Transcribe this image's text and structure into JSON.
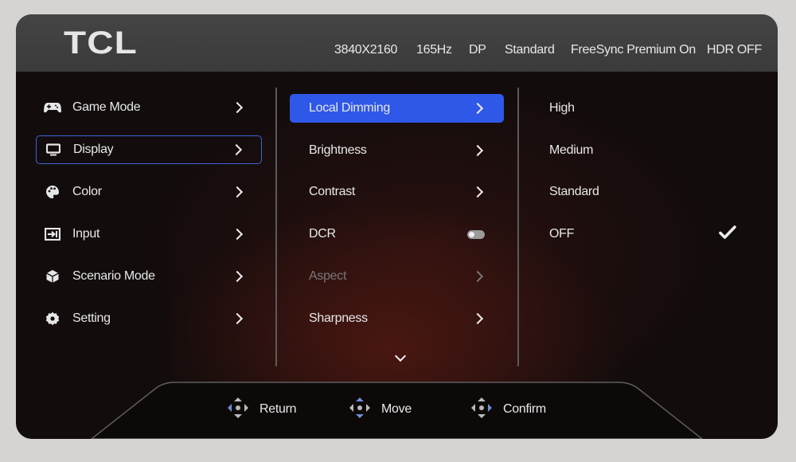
{
  "brand": "TCL",
  "status_bar": {
    "resolution": "3840X2160",
    "refresh_rate": "165Hz",
    "input_port": "DP",
    "picture_mode": "Standard",
    "freesync": "FreeSync Premium On",
    "hdr": "HDR OFF"
  },
  "main_menu": {
    "items": [
      {
        "label": "Game Mode",
        "icon": "gamepad-icon"
      },
      {
        "label": "Display",
        "icon": "monitor-icon",
        "focused": true
      },
      {
        "label": "Color",
        "icon": "palette-icon"
      },
      {
        "label": "Input",
        "icon": "input-icon"
      },
      {
        "label": "Scenario Mode",
        "icon": "cube-icon"
      },
      {
        "label": "Setting",
        "icon": "gear-icon"
      }
    ]
  },
  "display_submenu": {
    "items": [
      {
        "label": "Local Dimming",
        "selected": true,
        "control": "chevron"
      },
      {
        "label": "Brightness",
        "control": "chevron"
      },
      {
        "label": "Contrast",
        "control": "chevron"
      },
      {
        "label": "DCR",
        "control": "toggle",
        "toggle_on": false
      },
      {
        "label": "Aspect",
        "control": "chevron",
        "disabled": true
      },
      {
        "label": "Sharpness",
        "control": "chevron"
      }
    ],
    "more_indicator": "chevron-down-icon"
  },
  "local_dimming_options": {
    "items": [
      {
        "label": "High"
      },
      {
        "label": "Medium"
      },
      {
        "label": "Standard"
      },
      {
        "label": "OFF",
        "checked": true
      }
    ]
  },
  "footer": {
    "return_label": "Return",
    "move_label": "Move",
    "confirm_label": "Confirm"
  },
  "colors": {
    "selection": "#2f58e8",
    "focus_border": "#3e63d8",
    "dpad_blue": "#6f8ed6"
  }
}
